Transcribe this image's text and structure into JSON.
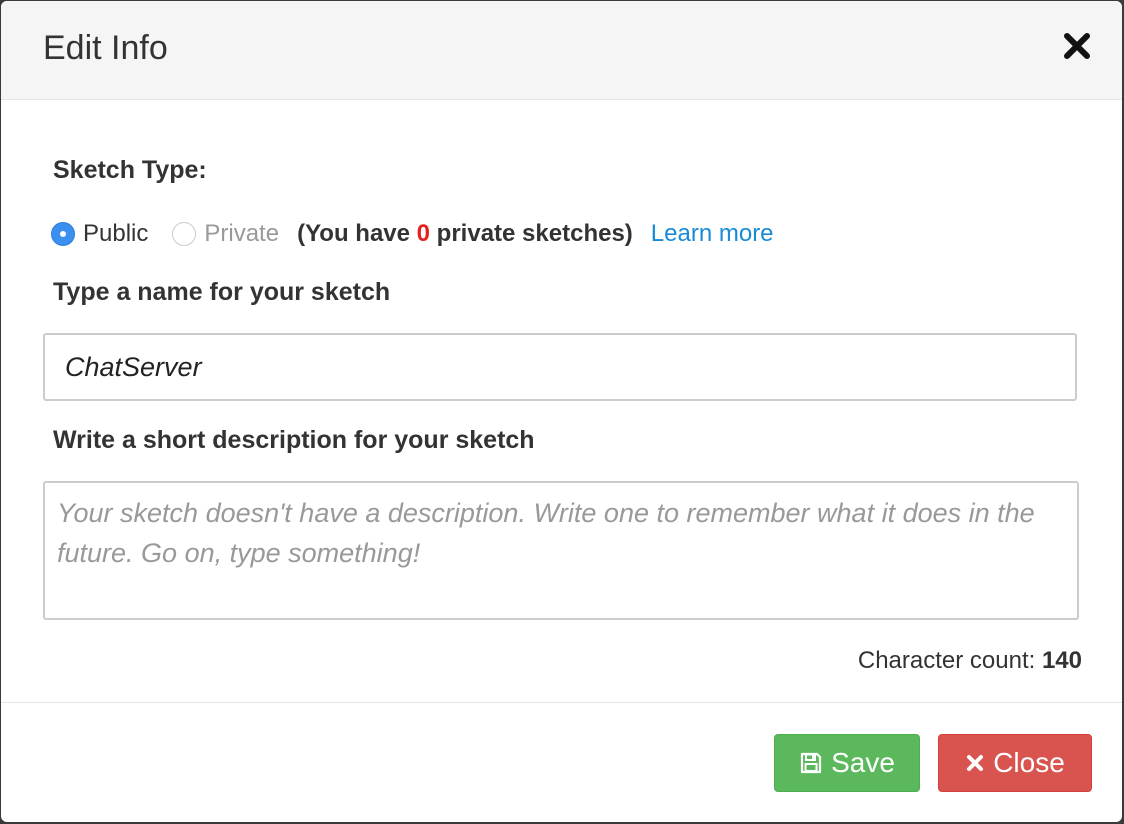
{
  "modal": {
    "title": "Edit Info"
  },
  "sketch_type": {
    "label": "Sketch Type:",
    "public_label": "Public",
    "private_label": "Private",
    "selected": "Public",
    "note_prefix": "(You have ",
    "private_count": "0",
    "note_suffix": " private sketches)",
    "learn_more": "Learn more",
    "colors": {
      "radio_checked": "#3b8ff0",
      "count": "#e81f1f",
      "link": "#1a8ad6"
    }
  },
  "name_field": {
    "label": "Type a name for your sketch",
    "value": "ChatServer"
  },
  "description_field": {
    "label": "Write a short description for your sketch",
    "placeholder": "Your sketch doesn't have a description. Write one to remember what it does in the future. Go on, type something!",
    "value": ""
  },
  "char_count": {
    "label": "Character count: ",
    "value": "140"
  },
  "footer": {
    "save_label": "Save",
    "close_label": "Close",
    "save_icon": "floppy-disk-icon",
    "close_icon": "close-icon",
    "colors": {
      "save": "#5cb85c",
      "close": "#d9534f"
    }
  }
}
